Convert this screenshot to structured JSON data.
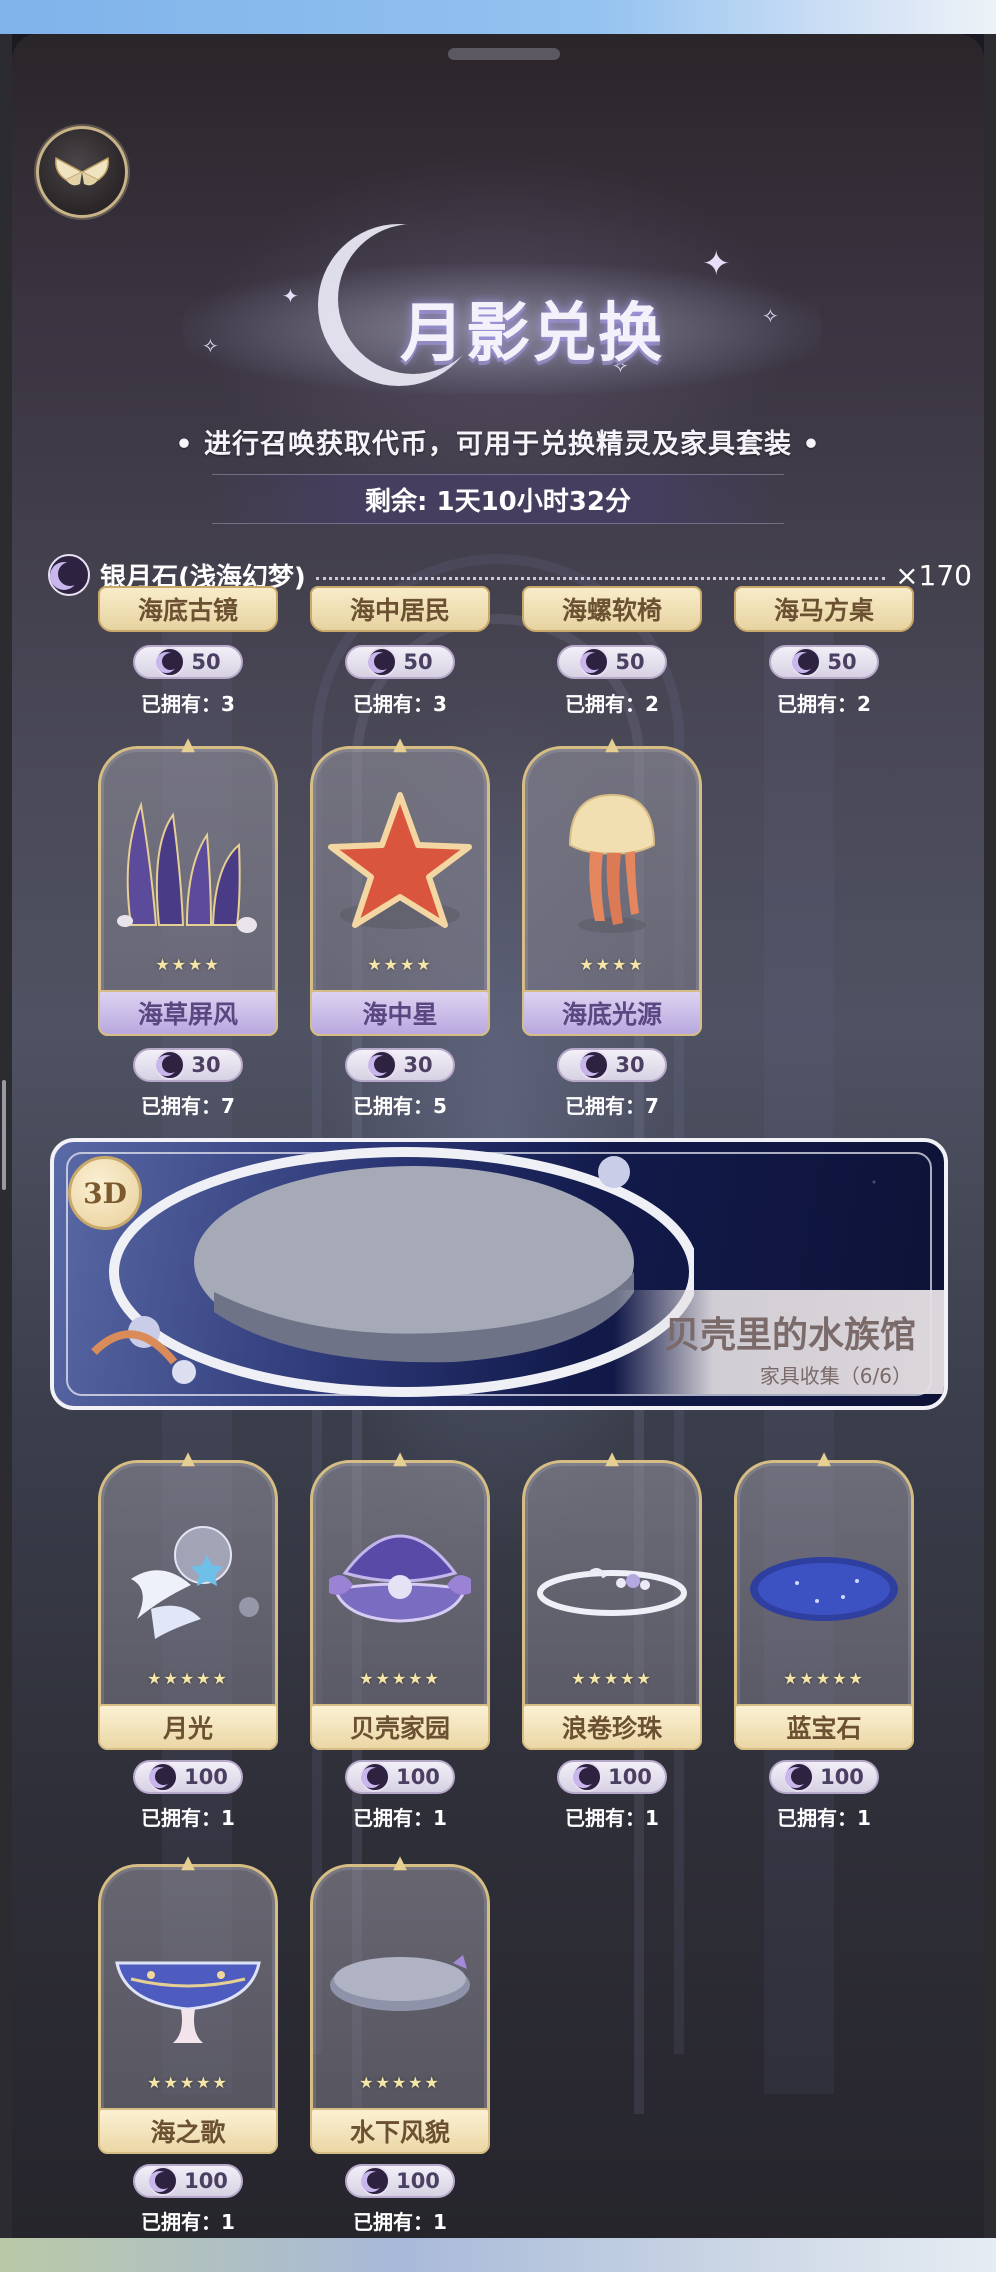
{
  "banner": {
    "title": "月影兑换",
    "subtitle": "• 进行召唤获取代币，可用于兑换精灵及家具套装 •",
    "timer": "剩余: 1天10小时32分"
  },
  "currency": {
    "name": "银月石(浅海幻梦)",
    "count": "×170",
    "icon": "crescent-moon-coin-icon"
  },
  "owned_prefix": "已拥有：",
  "row_partial": [
    {
      "name": "海底古镜",
      "cost": "50",
      "owned": "已拥有：3"
    },
    {
      "name": "海中居民",
      "cost": "50",
      "owned": "已拥有：3"
    },
    {
      "name": "海螺软椅",
      "cost": "50",
      "owned": "已拥有：2"
    },
    {
      "name": "海马方桌",
      "cost": "50",
      "owned": "已拥有：2"
    }
  ],
  "row_four_star": [
    {
      "name": "海草屏风",
      "cost": "30",
      "owned": "已拥有：7",
      "stars": "★★★★",
      "icon": "seaweed-screen-icon"
    },
    {
      "name": "海中星",
      "cost": "30",
      "owned": "已拥有：5",
      "stars": "★★★★",
      "icon": "starfish-icon"
    },
    {
      "name": "海底光源",
      "cost": "30",
      "owned": "已拥有：7",
      "stars": "★★★★",
      "icon": "jellyfish-lamp-icon"
    }
  ],
  "featured": {
    "badge": "3D",
    "title": "贝壳里的水族馆",
    "subtitle": "家具收集（6/6）"
  },
  "row_five_star_a": [
    {
      "name": "月光",
      "cost": "100",
      "owned": "已拥有：1",
      "stars": "★★★★★",
      "icon": "moonlight-jellyfish-icon"
    },
    {
      "name": "贝壳家园",
      "cost": "100",
      "owned": "已拥有：1",
      "stars": "★★★★★",
      "icon": "shell-home-icon"
    },
    {
      "name": "浪卷珍珠",
      "cost": "100",
      "owned": "已拥有：1",
      "stars": "★★★★★",
      "icon": "pearl-ring-icon"
    },
    {
      "name": "蓝宝石",
      "cost": "100",
      "owned": "已拥有：1",
      "stars": "★★★★★",
      "icon": "sapphire-rug-icon"
    }
  ],
  "row_five_star_b": [
    {
      "name": "海之歌",
      "cost": "100",
      "owned": "已拥有：1",
      "stars": "★★★★★",
      "icon": "sea-song-bowl-icon"
    },
    {
      "name": "水下风貌",
      "cost": "100",
      "owned": "已拥有：1",
      "stars": "★★★★★",
      "icon": "underwater-platform-icon"
    }
  ],
  "colors": {
    "gold_border": "#d6bd84",
    "purple_label": "#b8a8df",
    "gold_label": "#ebd7a6",
    "dark_bg": "#1b1a22"
  }
}
